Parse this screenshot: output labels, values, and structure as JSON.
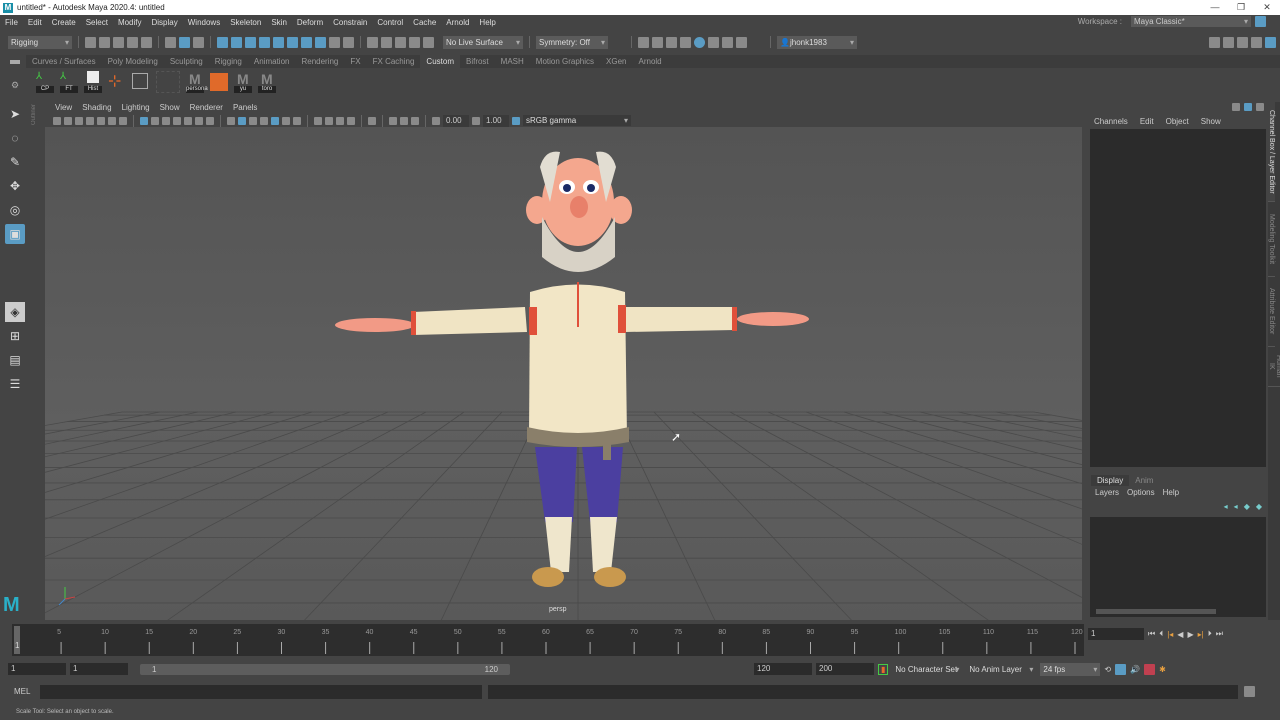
{
  "window": {
    "title": "untitled* - Autodesk Maya 2020.4: untitled",
    "logo": "M",
    "min": "—",
    "max": "❐",
    "close": "✕"
  },
  "menubar": [
    "File",
    "Edit",
    "Create",
    "Select",
    "Modify",
    "Display",
    "Windows",
    "Skeleton",
    "Skin",
    "Deform",
    "Constrain",
    "Control",
    "Cache",
    "Arnold",
    "Help"
  ],
  "workspace": {
    "label": "Workspace :",
    "value": "Maya Classic*"
  },
  "statusline": {
    "menuset": "Rigging",
    "live_surface": "No Live Surface",
    "symmetry": "Symmetry: Off",
    "user": "jhonk1983"
  },
  "shelf": {
    "tabs": [
      "Curves / Surfaces",
      "Poly Modeling",
      "Sculpting",
      "Rigging",
      "Animation",
      "Rendering",
      "FX",
      "FX Caching",
      "Custom",
      "Bifrost",
      "MASH",
      "Motion Graphics",
      "XGen",
      "Arnold"
    ],
    "active": "Custom",
    "buttons": [
      "CP",
      "FT",
      "Hist",
      "",
      "",
      "persona",
      "",
      "yu",
      "toro"
    ]
  },
  "viewport": {
    "menu": [
      "View",
      "Shading",
      "Lighting",
      "Show",
      "Renderer",
      "Panels"
    ],
    "exposure": "0.00",
    "gamma": "1.00",
    "colorspace": "sRGB gamma",
    "camera": "persp",
    "outliner_label": "Outliner"
  },
  "channelbox": {
    "menu": [
      "Channels",
      "Edit",
      "Object",
      "Show"
    ]
  },
  "layers": {
    "tabs": [
      "Display",
      "Anim"
    ],
    "menu": [
      "Layers",
      "Options",
      "Help"
    ]
  },
  "side_tabs": [
    "Channel Box / Layer Editor",
    "Modeling Toolkit",
    "Attribute Editor",
    "Human IK"
  ],
  "timeline": {
    "ticks": [
      5,
      10,
      15,
      20,
      25,
      30,
      35,
      40,
      45,
      50,
      55,
      60,
      65,
      70,
      75,
      80,
      85,
      90,
      95,
      100,
      105,
      110,
      115,
      120
    ],
    "current": "1",
    "current_field": "1"
  },
  "range": {
    "start": "1",
    "playback_start": "1",
    "slider_start": "1",
    "slider_end": "120",
    "playback_end": "120",
    "end": "200",
    "character_set": "No Character Set",
    "anim_layer": "No Anim Layer",
    "fps": "24 fps"
  },
  "cmdline": {
    "lang": "MEL"
  },
  "helpline": "Scale Tool: Select an object to scale."
}
